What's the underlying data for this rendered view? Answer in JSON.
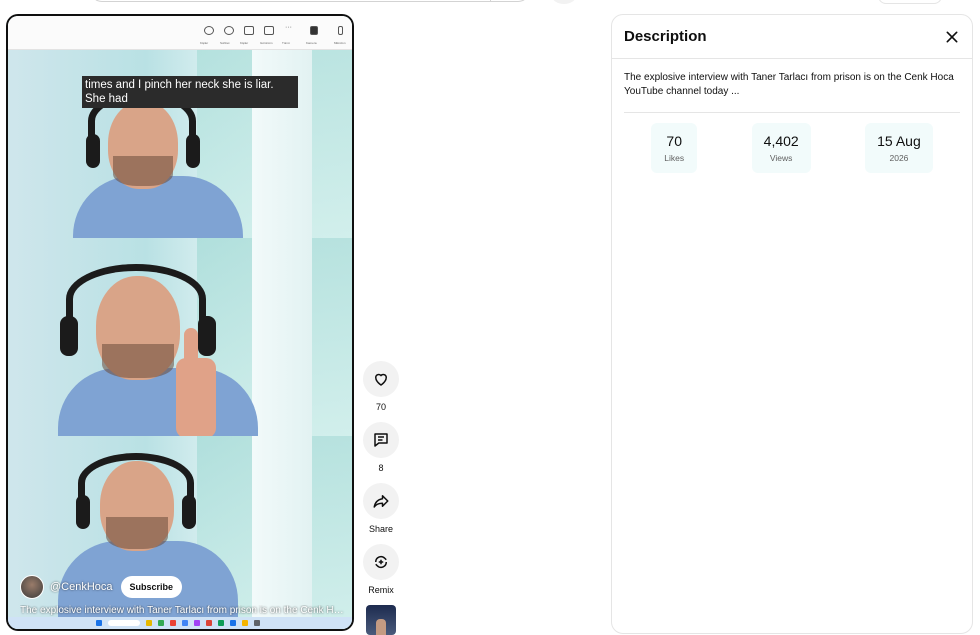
{
  "video": {
    "caption_line1": "times and I pinch her neck she is liar.",
    "caption_line2": "She had",
    "channel_name": "@CenkHoca",
    "subscribe_label": "Subscribe",
    "title": "The explosive interview with Taner Tarlacı from prison is on the Cenk Hoca YouTube channel today ...",
    "meet_toolbar_labels": [
      "Kişiler",
      "Sohbet",
      "Kişiler",
      "Görünüm",
      "Tümü",
      "Kamera",
      "Mikrofon"
    ]
  },
  "actions": {
    "like_count": "70",
    "comment_count": "8",
    "share_label": "Share",
    "remix_label": "Remix"
  },
  "panel": {
    "heading": "Description",
    "description": "The explosive interview with Taner Tarlacı from prison is on the Cenk Hoca YouTube channel today ...",
    "stats": {
      "likes_value": "70",
      "likes_label": "Likes",
      "views_value": "4,402",
      "views_label": "Views",
      "date_value": "15 Aug",
      "date_label": "2026"
    }
  },
  "colors": {
    "accent_chip": "#f2fbfb",
    "button_bg": "#f2f2f2",
    "text": "#0f0f0f"
  }
}
